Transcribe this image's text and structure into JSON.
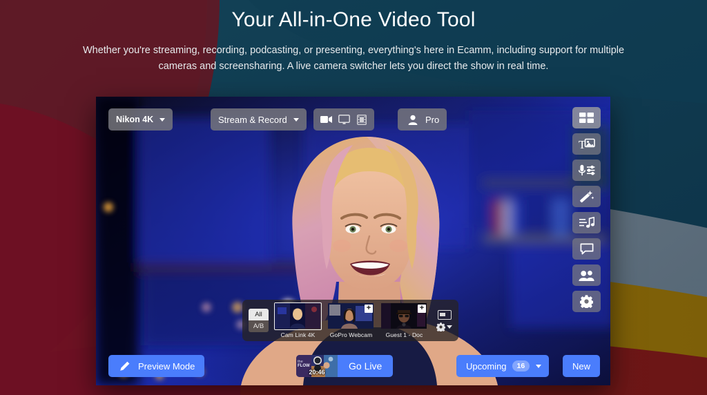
{
  "hero": {
    "title": "Your All-in-One Video Tool",
    "subtitle": "Whether you're streaming, recording, podcasting, or presenting, everything's here in Ecamm, including support for multiple cameras and screensharing. A live camera switcher lets you direct the show in real time."
  },
  "colors": {
    "maroon_top_left": "#5e1a26",
    "crimson_bottom_left": "#6b0f26",
    "teal_top_right": "#0f4a5e",
    "navy_deep": "#123b52",
    "slate_band": "#6e7b87",
    "gold_band": "#8a6a0a",
    "dark_red_band": "#7a1c1c",
    "accent_blue": "#4a7dfc",
    "toolbar_gray": "#76767c"
  },
  "app": {
    "toolbar": {
      "source": {
        "label": "Nikon 4K",
        "icon": "chevron-down-icon"
      },
      "mode": {
        "label": "Stream & Record",
        "icon": "chevron-down-icon"
      },
      "view_icons": [
        {
          "name": "camera-icon",
          "active": true
        },
        {
          "name": "screen-share-icon",
          "active": false
        },
        {
          "name": "film-strip-icon",
          "active": false
        }
      ],
      "account": {
        "label": "Pro",
        "icon": "person-icon"
      }
    },
    "rail": [
      {
        "name": "layouts-icon",
        "label": "Layouts",
        "selected": true
      },
      {
        "name": "text-overlay-icon",
        "label": "Overlays",
        "selected": false
      },
      {
        "name": "audio-mixer-icon",
        "label": "Audio",
        "selected": false
      },
      {
        "name": "magic-wand-icon",
        "label": "Effects",
        "selected": false
      },
      {
        "name": "music-notes-icon",
        "label": "Sound",
        "selected": false
      },
      {
        "name": "chat-bubble-icon",
        "label": "Comments",
        "selected": false
      },
      {
        "name": "people-icon",
        "label": "Guests",
        "selected": false
      },
      {
        "name": "gear-icon",
        "label": "Settings",
        "selected": false
      }
    ],
    "switcher": {
      "mode_all": "All",
      "mode_ab": "A/B",
      "cameras": [
        {
          "label": "Cam Link 4K",
          "active": true,
          "add_badge": false
        },
        {
          "label": "GoPro Webcam",
          "active": false,
          "add_badge": true,
          "badge": "+"
        },
        {
          "label": "Guest 1 - Doc",
          "active": false,
          "add_badge": true,
          "badge": "+"
        }
      ],
      "pip_icon": "picture-in-picture-icon",
      "settings_icon": "gear-icon",
      "settings_caret": "chevron-down-icon"
    },
    "bottom": {
      "preview": {
        "label": "Preview Mode",
        "icon": "pencil-icon"
      },
      "go_live": {
        "label": "Go Live",
        "thumb_time": "20:46",
        "thumb_title": "the FLOW"
      },
      "upcoming": {
        "label": "Upcoming",
        "count": "16",
        "icon": "chevron-down-icon"
      },
      "new": {
        "label": "New"
      }
    }
  }
}
